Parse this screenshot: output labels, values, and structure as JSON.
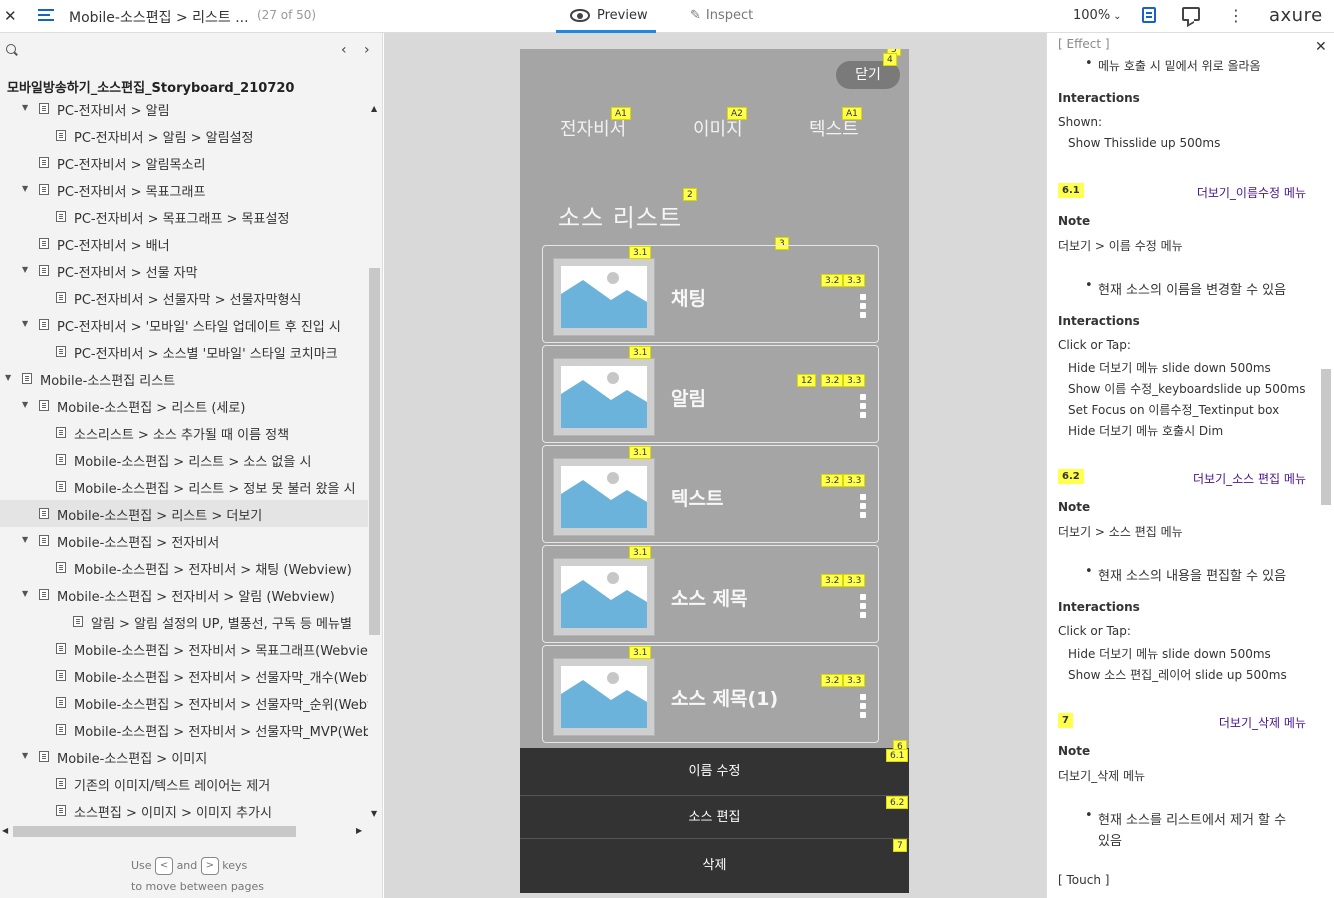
{
  "topbar": {
    "close": "✕",
    "title": "Mobile-소스편집 > 리스트 ...",
    "count": "(27 of 50)",
    "preview": "Preview",
    "inspect": "Inspect",
    "inspect_icon": "✎",
    "zoom": "100%",
    "zoom_chevron": "⌄",
    "more": "⋮",
    "logo": "axure"
  },
  "sidebar": {
    "prev": "‹",
    "next": "›",
    "project": "모바일방송하기_소스편집_Storyboard_210720",
    "items": [
      {
        "label": "PC-전자비서 > 알림",
        "arrow": "▼"
      },
      {
        "label": "PC-전자비서 > 알림 > 알림설정",
        "arrow": ""
      },
      {
        "label": "PC-전자비서 > 알림목소리",
        "arrow": ""
      },
      {
        "label": "PC-전자비서 > 목표그래프",
        "arrow": "▼"
      },
      {
        "label": "PC-전자비서 > 목표그래프 > 목표설정",
        "arrow": ""
      },
      {
        "label": "PC-전자비서 > 배너",
        "arrow": ""
      },
      {
        "label": "PC-전자비서 > 선물 자막",
        "arrow": "▼"
      },
      {
        "label": "PC-전자비서 > 선물자막 > 선물자막형식",
        "arrow": ""
      },
      {
        "label": "PC-전자비서 > '모바일' 스타일 업데이트 후 진입 시",
        "arrow": "▼"
      },
      {
        "label": "PC-전자비서 > 소스별 '모바일' 스타일 코치마크",
        "arrow": ""
      },
      {
        "label": "Mobile-소스편집 리스트",
        "arrow": "▼"
      },
      {
        "label": "Mobile-소스편집 > 리스트 (세로)",
        "arrow": "▼"
      },
      {
        "label": "소스리스트 > 소스 추가될 때 이름 정책",
        "arrow": ""
      },
      {
        "label": "Mobile-소스편집 > 리스트 > 소스 없을 시",
        "arrow": ""
      },
      {
        "label": "Mobile-소스편집 > 리스트 > 정보 못 불러 왔을 시",
        "arrow": ""
      },
      {
        "label": "Mobile-소스편집 > 리스트 > 더보기",
        "arrow": ""
      },
      {
        "label": "Mobile-소스편집 > 전자비서",
        "arrow": "▼"
      },
      {
        "label": "Mobile-소스편집 > 전자비서 > 채팅 (Webview)",
        "arrow": ""
      },
      {
        "label": "Mobile-소스편집 > 전자비서 > 알림 (Webview)",
        "arrow": "▼"
      },
      {
        "label": "알림 > 알림 설정의 UP, 별풍선, 구독 등 메뉴별",
        "arrow": ""
      },
      {
        "label": "Mobile-소스편집 > 전자비서 > 목표그래프(Webview)",
        "arrow": ""
      },
      {
        "label": "Mobile-소스편집 > 전자비서 > 선물자막_개수(Webview)",
        "arrow": ""
      },
      {
        "label": "Mobile-소스편집 > 전자비서 > 선물자막_순위(Webview)",
        "arrow": ""
      },
      {
        "label": "Mobile-소스편집 > 전자비서 > 선물자막_MVP(Webview)",
        "arrow": ""
      },
      {
        "label": "Mobile-소스편집 > 이미지",
        "arrow": "▼"
      },
      {
        "label": "기존의 이미지/텍스트 레이어는 제거",
        "arrow": ""
      },
      {
        "label": "소스편집 > 이미지 > 이미지 추가시",
        "arrow": ""
      }
    ],
    "scroll_up": "▲",
    "scroll_down": "▼",
    "scroll_left": "◀",
    "scroll_right": "▶",
    "hint_use": "Use",
    "hint_and": "and",
    "hint_keys": "keys",
    "hint_left_key": "<",
    "hint_right_key": ">",
    "hint_line2": "to move between pages"
  },
  "phone": {
    "close": "닫기",
    "tabs": [
      "전자비서",
      "이미지",
      "텍스트"
    ],
    "tab_tags": [
      "A1",
      "A2",
      "A1"
    ],
    "list_title": "소스 리스트",
    "cards": [
      "채팅",
      "알림",
      "텍스트",
      "소스 제목",
      "소스 제목(1)"
    ],
    "tags": {
      "close": "4",
      "top": "5",
      "list_title": "2",
      "list": "3",
      "thumb": "3.1",
      "a": "3.2",
      "b": "3.3",
      "alarm": "12",
      "sheet": "6",
      "sheet_first": "6.1",
      "sheet_edit": "6.2",
      "sheet_delete": "7"
    },
    "sheet": [
      "이름 수정",
      "소스 편집",
      "삭제"
    ]
  },
  "notes": {
    "close": "✕",
    "top_cut": "[ Effect ]",
    "effect_bullet": "메뉴 호출 시 밑에서 위로 올라옴",
    "interactions": "Interactions",
    "shown": "Shown:",
    "shown_action": "Show Thisslide up 500ms",
    "note": "Note",
    "click_tap": "Click or Tap:",
    "sections": [
      {
        "tag": "6.1",
        "name": "더보기_이름수정 메뉴",
        "note": "더보기 > 이름 수정 메뉴",
        "bullet": "현재 소스의 이름을 변경할 수 있음",
        "actions": [
          "Hide 더보기 메뉴 slide down 500ms",
          "Show 이름 수정_keyboardslide up 500ms",
          "Set Focus on 이름수정_Textinput box",
          "Hide 더보기 메뉴 호출시 Dim"
        ]
      },
      {
        "tag": "6.2",
        "name": "더보기_소스 편집 메뉴",
        "note": "더보기 > 소스 편집 메뉴",
        "bullet": "현재 소스의 내용을 편집할 수 있음",
        "actions": [
          "Hide 더보기 메뉴 slide down 500ms",
          "Show 소스 편집_레이어 slide up 500ms"
        ]
      },
      {
        "tag": "7",
        "name": "더보기_삭제 메뉴",
        "note": "더보기_삭제 메뉴",
        "bullet_l1": "현재 소스를 리스트에서 제거 할 수",
        "bullet_l2": "있음",
        "touch": "[ Touch ]"
      }
    ]
  }
}
